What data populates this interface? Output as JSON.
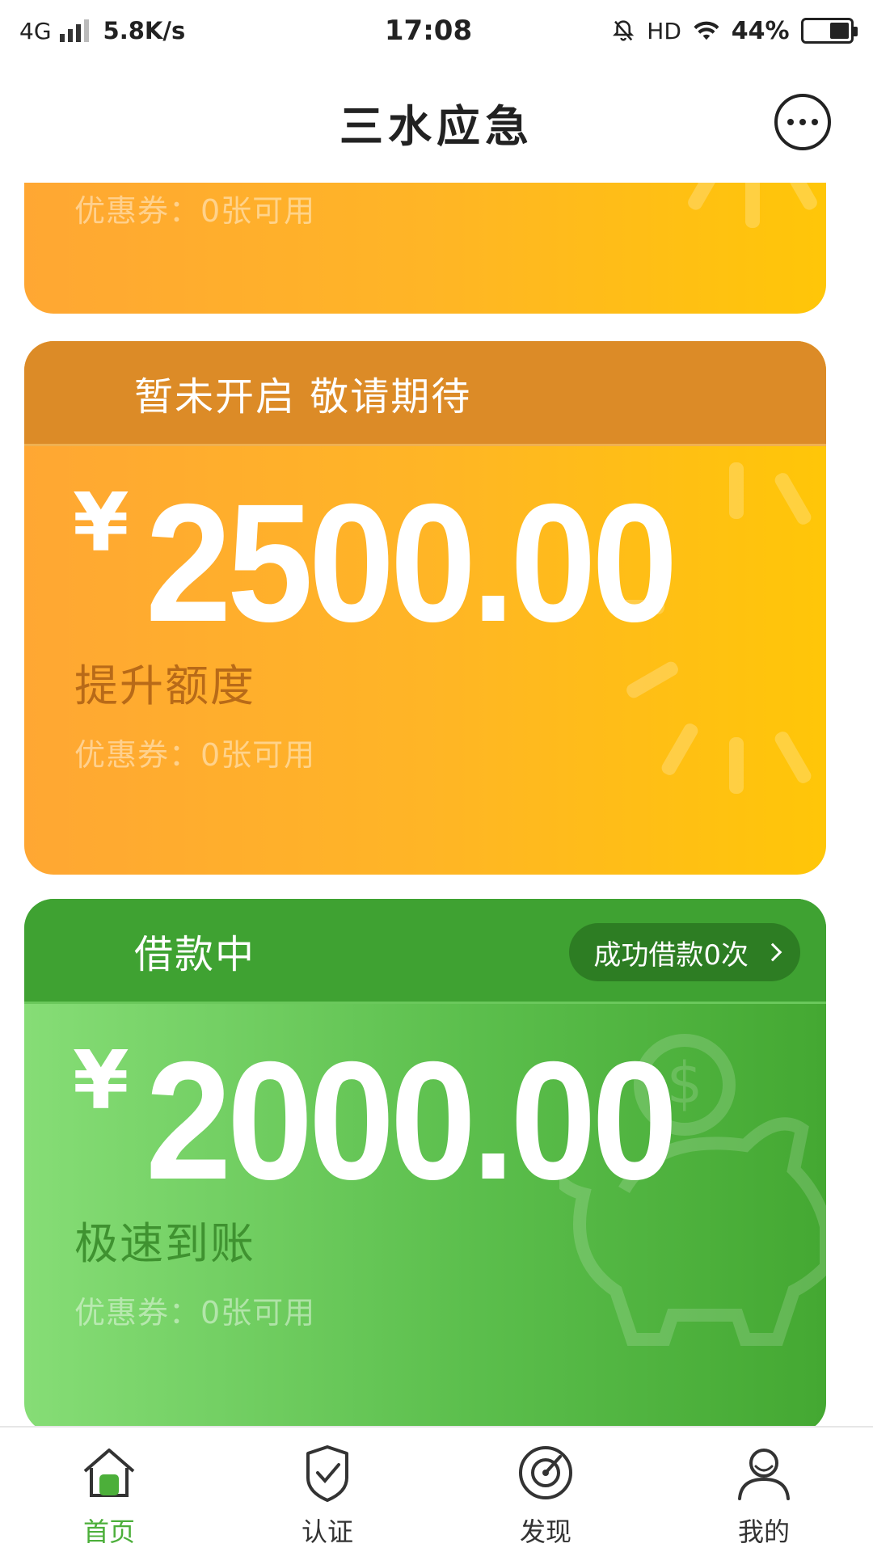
{
  "status_bar": {
    "network": "4G",
    "speed": "5.8K/s",
    "time": "17:08",
    "hd": "HD",
    "battery_pct": "44%",
    "battery_level": 0.44
  },
  "header": {
    "title": "三水应急",
    "chat_icon": "chat-bubble-icon"
  },
  "cards": [
    {
      "coupon": "优惠券：0张可用"
    },
    {
      "header": "暂未开启 敬请期待",
      "currency": "¥",
      "amount": "2500.00",
      "subtitle": "提升额度",
      "coupon": "优惠券：0张可用"
    },
    {
      "header": "借款中",
      "pill": "成功借款0次",
      "currency": "¥",
      "amount": "2000.00",
      "subtitle": "极速到账",
      "coupon": "优惠券：0张可用"
    }
  ],
  "bottom_nav": [
    {
      "label": "首页",
      "icon": "home-icon",
      "active": true
    },
    {
      "label": "认证",
      "icon": "shield-check-icon",
      "active": false
    },
    {
      "label": "发现",
      "icon": "compass-icon",
      "active": false
    },
    {
      "label": "我的",
      "icon": "user-icon",
      "active": false
    }
  ],
  "colors": {
    "accent_green": "#4caf3a",
    "orange_header": "#dc8b27",
    "green_header": "#3fa232"
  }
}
